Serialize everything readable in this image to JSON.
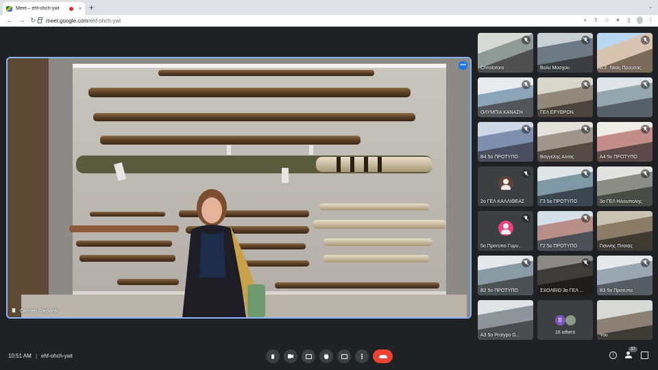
{
  "browser": {
    "tab_title": "Meet – ehf-ohch-ywt",
    "tab_close": "×",
    "new_tab": "+",
    "url_host": "meet.google.com",
    "url_path": "/ehf-ohch-ywt"
  },
  "main": {
    "presenter_name": "Carmen Gagliardi"
  },
  "tiles": [
    {
      "name": "Christoforo",
      "kind": "video"
    },
    {
      "name": "Βολυ Μοσχου",
      "kind": "video"
    },
    {
      "name": "Δ.Σ. Νέας Προύσας",
      "kind": "video"
    },
    {
      "name": "ΟΛΥΜΠΙΑ ΚΑΝΑΣΗ",
      "kind": "video"
    },
    {
      "name": "ΓΕΛ ΕΡΥΘΡΩΝ",
      "kind": "video"
    },
    {
      "name": "",
      "kind": "video"
    },
    {
      "name": "Β4 5ο ΠΡΟΤΥΠΟ",
      "kind": "video"
    },
    {
      "name": "Βαγγέλης Αλτας",
      "kind": "video"
    },
    {
      "name": "Α4 5ο ΠΡΟΤΥΠΟ",
      "kind": "video"
    },
    {
      "name": "2ο ΓΕΛ ΚΑΛΛΙΘΕΑΣ",
      "kind": "avatar",
      "avatar_color": "#5f4339"
    },
    {
      "name": "Γ3 5ο ΠΡΟΤΥΠΟ",
      "kind": "video"
    },
    {
      "name": "3ο ΓΕΛ Ηλιούπολης",
      "kind": "video"
    },
    {
      "name": "5o Πρότυπο Γυμν...",
      "kind": "avatar",
      "avatar_color": "#e8437a"
    },
    {
      "name": "Γ2 5ο ΠΡΟΤΥΠΟ",
      "kind": "video"
    },
    {
      "name": "Γιάννης Πιτσιάς",
      "kind": "video"
    },
    {
      "name": "Β2 5ο ΠΡΟΤΥΠΟ",
      "kind": "video"
    },
    {
      "name": "ΣΧΟΛΕΙΟ 3ο ΓΕΛ ...",
      "kind": "video"
    },
    {
      "name": "Β3 5ο Πρότυπο",
      "kind": "video"
    },
    {
      "name": "Α3 5ο Protypo G...",
      "kind": "video"
    },
    {
      "name": "16 others",
      "kind": "others",
      "initial": "B"
    },
    {
      "name": "You",
      "kind": "video"
    }
  ],
  "bottom": {
    "time": "10:51 AM",
    "separator": "|",
    "meeting_code": "ehf-ohch-ywt",
    "participant_count": "37",
    "info_label": "i"
  },
  "colors": {
    "accent": "#8ab4f8",
    "end_call": "#ea4335",
    "surface": "#202124",
    "tile": "#3c4043"
  }
}
